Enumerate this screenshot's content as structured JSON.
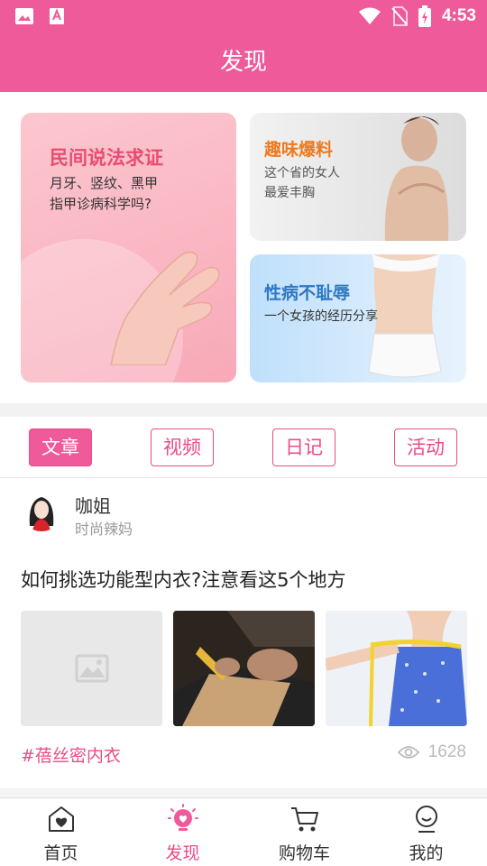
{
  "status_bar": {
    "time": "4:53",
    "icons": [
      "image-icon",
      "app-icon",
      "wifi-icon",
      "no-sim-icon",
      "battery-charging-icon"
    ]
  },
  "header": {
    "title": "发现"
  },
  "banners": {
    "main": {
      "title": "民间说法求证",
      "subtitle_line1": "月牙、竖纹、黑甲",
      "subtitle_line2": "指甲诊病科学吗?"
    },
    "top_right": {
      "title": "趣味爆料",
      "subtitle_line1": "这个省的女人",
      "subtitle_line2": "最爱丰胸"
    },
    "bottom_right": {
      "title": "性病不耻辱",
      "subtitle": "一个女孩的经历分享"
    }
  },
  "tabs": [
    {
      "label": "文章",
      "active": true
    },
    {
      "label": "视频",
      "active": false
    },
    {
      "label": "日记",
      "active": false
    },
    {
      "label": "活动",
      "active": false
    }
  ],
  "article": {
    "author": "咖姐",
    "author_tag": "时尚辣妈",
    "title": "如何挑选功能型内衣?注意看这5个地方",
    "hashtag": "#蓓丝密内衣",
    "views": "1628"
  },
  "bottom_nav": [
    {
      "label": "首页",
      "icon": "home-heart-icon",
      "active": false
    },
    {
      "label": "发现",
      "icon": "lightbulb-heart-icon",
      "active": true
    },
    {
      "label": "购物车",
      "icon": "cart-icon",
      "active": false
    },
    {
      "label": "我的",
      "icon": "profile-icon",
      "active": false
    }
  ],
  "colors": {
    "brand_pink": "#ee5a9a",
    "accent_pink": "#e94c87",
    "orange": "#ef7a1d",
    "blue": "#2f78c4"
  }
}
